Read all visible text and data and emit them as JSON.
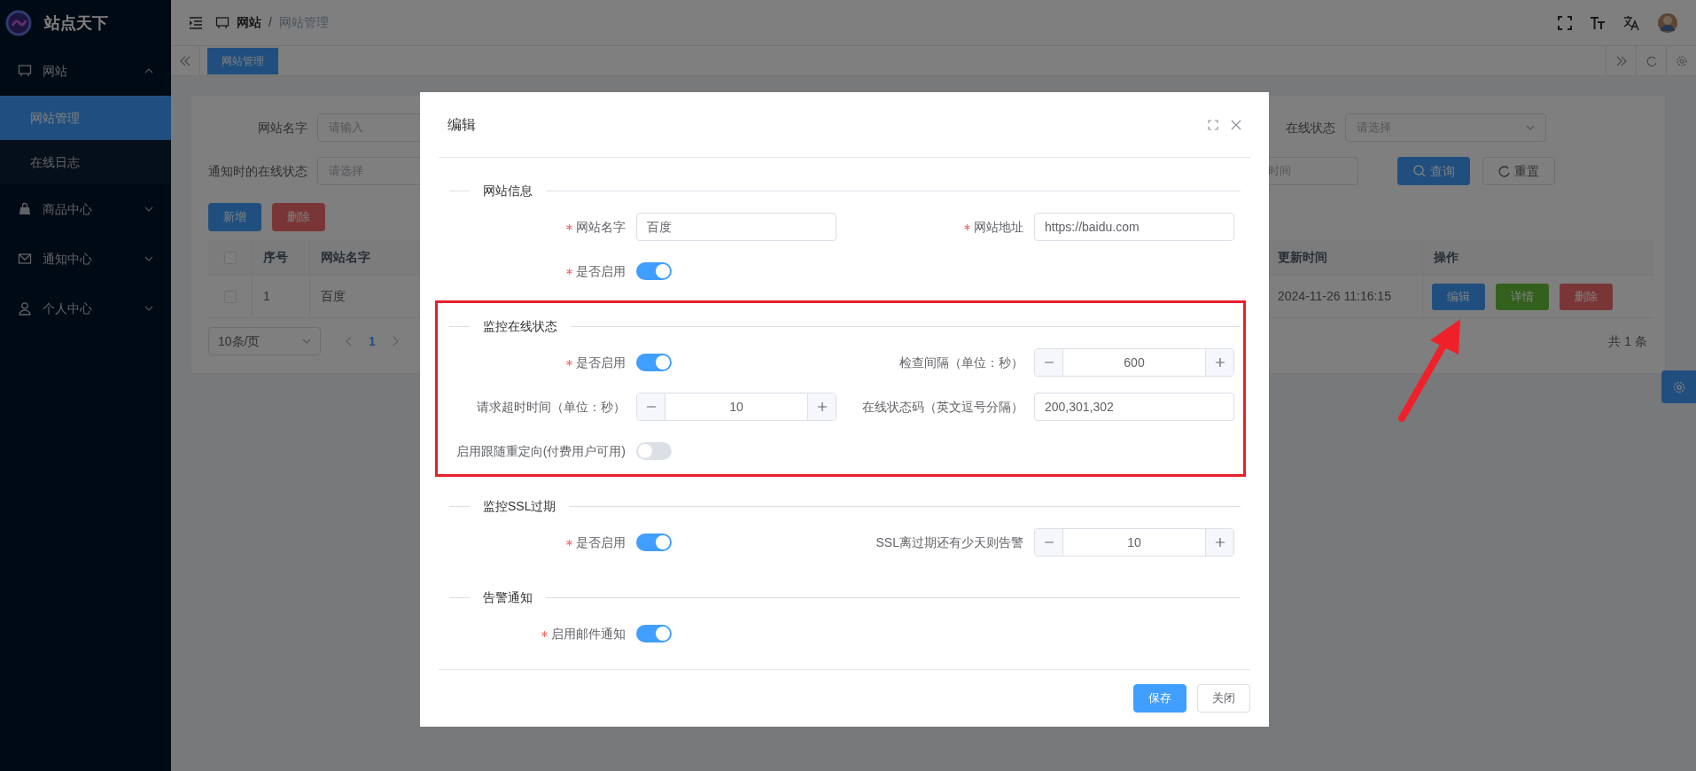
{
  "sidebar": {
    "logo_text": "站点天下",
    "items": [
      {
        "label": "网站",
        "expanded": true,
        "children": [
          {
            "label": "网站管理",
            "selected": true
          },
          {
            "label": "在线日志",
            "selected": false
          }
        ]
      },
      {
        "label": "商品中心",
        "expanded": false
      },
      {
        "label": "通知中心",
        "expanded": false
      },
      {
        "label": "个人中心",
        "expanded": false
      }
    ]
  },
  "header": {
    "breadcrumb": [
      "网站",
      "网站管理"
    ],
    "separator": "/"
  },
  "tabs": [
    {
      "label": "网站管理",
      "selected": true
    }
  ],
  "filters": {
    "row_1": [
      {
        "label": "网站名字",
        "placeholder": "请输入"
      },
      {
        "label": "在线状态",
        "placeholder": "请选择",
        "kind": "select"
      }
    ],
    "row_2": [
      {
        "label": "通知时的在线状态",
        "placeholder": "请选择"
      },
      {
        "placeholder": "时间"
      }
    ],
    "buttons": [
      "查询",
      "重置"
    ]
  },
  "toolbar": [
    "新增",
    "删除"
  ],
  "table": {
    "columns": [
      "序号",
      "网站名字",
      "更新时间",
      "操作"
    ],
    "header_checked": false,
    "rows": [
      {
        "checked": false,
        "cells": [
          "1",
          "百度",
          "2024-11-26 11:16:15"
        ],
        "actions": [
          "编辑",
          "详情",
          "删除"
        ]
      }
    ]
  },
  "pagination": {
    "page_size": "10条/页",
    "pages": [
      {
        "label": "1",
        "selected": true
      }
    ],
    "total": "共 1 条"
  },
  "dialog": {
    "title": "编辑",
    "sections": [
      {
        "title": "网站信息",
        "highlighted": false,
        "fields": [
          {
            "kind": "text",
            "label": "网站名字",
            "required": true,
            "value": "百度"
          },
          {
            "kind": "text",
            "label": "网站地址",
            "required": true,
            "value": "https://baidu.com"
          },
          {
            "kind": "switch",
            "label": "是否启用",
            "required": true,
            "on": true
          }
        ]
      },
      {
        "title": "监控在线状态",
        "highlighted": true,
        "fields": [
          {
            "kind": "switch",
            "label": "是否启用",
            "required": true,
            "on": true
          },
          {
            "kind": "number",
            "label": "检查间隔（单位：秒）",
            "required": false,
            "value": "600"
          },
          {
            "kind": "number",
            "label": "请求超时时间（单位：秒）",
            "required": false,
            "value": "10"
          },
          {
            "kind": "text",
            "label": "在线状态码（英文逗号分隔）",
            "required": false,
            "value": "200,301,302"
          },
          {
            "kind": "switch",
            "label": "启用跟随重定向(付费用户可用)",
            "required": false,
            "on": false
          }
        ]
      },
      {
        "title": "监控SSL过期",
        "highlighted": false,
        "fields": [
          {
            "kind": "switch",
            "label": "是否启用",
            "required": true,
            "on": true
          },
          {
            "kind": "number",
            "label": "SSL离过期还有少天则告警",
            "required": false,
            "value": "10"
          }
        ]
      },
      {
        "title": "告警通知",
        "highlighted": false,
        "fields": [
          {
            "kind": "switch",
            "label": "启用邮件通知",
            "required": true,
            "on": true
          }
        ]
      }
    ],
    "buttons": [
      {
        "label": "保存",
        "kind": "primary"
      },
      {
        "label": "关闭",
        "kind": "default"
      }
    ]
  }
}
